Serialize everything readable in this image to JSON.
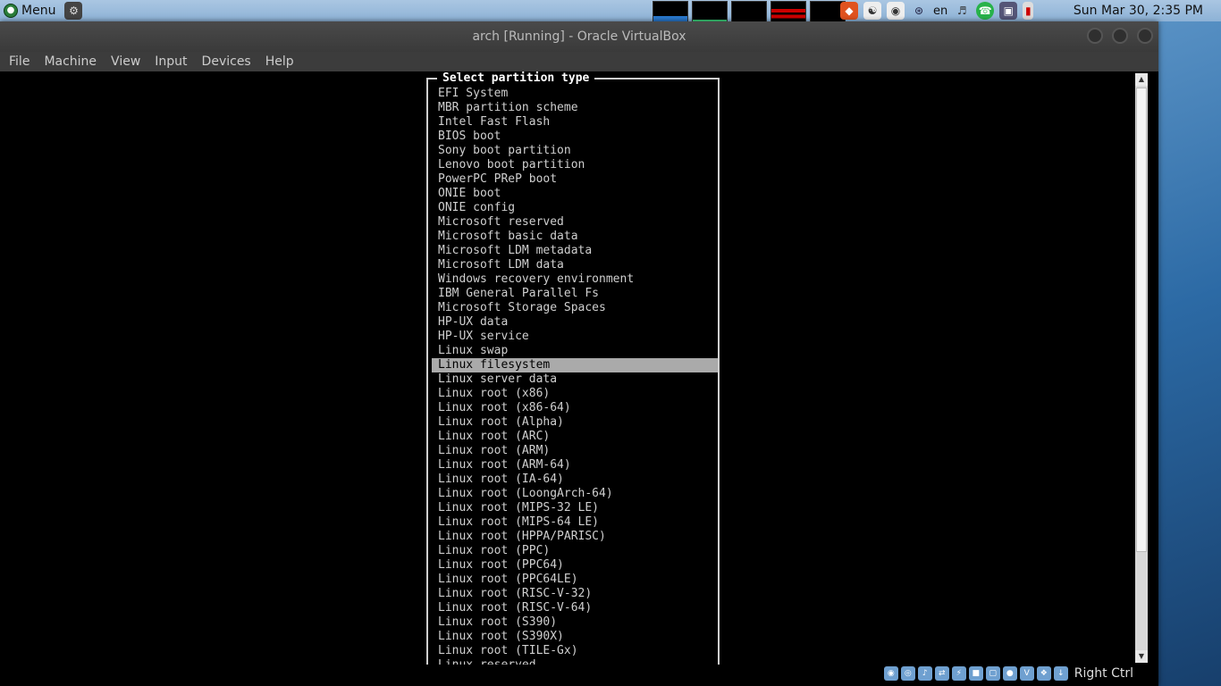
{
  "top_panel": {
    "menu_label": "Menu",
    "clock": "Sun Mar 30,  2:35 PM",
    "keyboard_layout": "en"
  },
  "window": {
    "title": "arch  [Running] - Oracle VirtualBox",
    "menu": [
      "File",
      "Machine",
      "View",
      "Input",
      "Devices",
      "Help"
    ]
  },
  "dialog": {
    "title": "Select partition type",
    "selected_index": 19,
    "items": [
      "EFI System",
      "MBR partition scheme",
      "Intel Fast Flash",
      "BIOS boot",
      "Sony boot partition",
      "Lenovo boot partition",
      "PowerPC PReP boot",
      "ONIE boot",
      "ONIE config",
      "Microsoft reserved",
      "Microsoft basic data",
      "Microsoft LDM metadata",
      "Microsoft LDM data",
      "Windows recovery environment",
      "IBM General Parallel Fs",
      "Microsoft Storage Spaces",
      "HP-UX data",
      "HP-UX service",
      "Linux swap",
      "Linux filesystem",
      "Linux server data",
      "Linux root (x86)",
      "Linux root (x86-64)",
      "Linux root (Alpha)",
      "Linux root (ARC)",
      "Linux root (ARM)",
      "Linux root (ARM-64)",
      "Linux root (IA-64)",
      "Linux root (LoongArch-64)",
      "Linux root (MIPS-32 LE)",
      "Linux root (MIPS-64 LE)",
      "Linux root (HPPA/PARISC)",
      "Linux root (PPC)",
      "Linux root (PPC64)",
      "Linux root (PPC64LE)",
      "Linux root (RISC-V-32)",
      "Linux root (RISC-V-64)",
      "Linux root (S390)",
      "Linux root (S390X)",
      "Linux root (TILE-Gx)",
      "Linux reserved"
    ]
  },
  "statusbar": {
    "host_key": "Right Ctrl"
  }
}
